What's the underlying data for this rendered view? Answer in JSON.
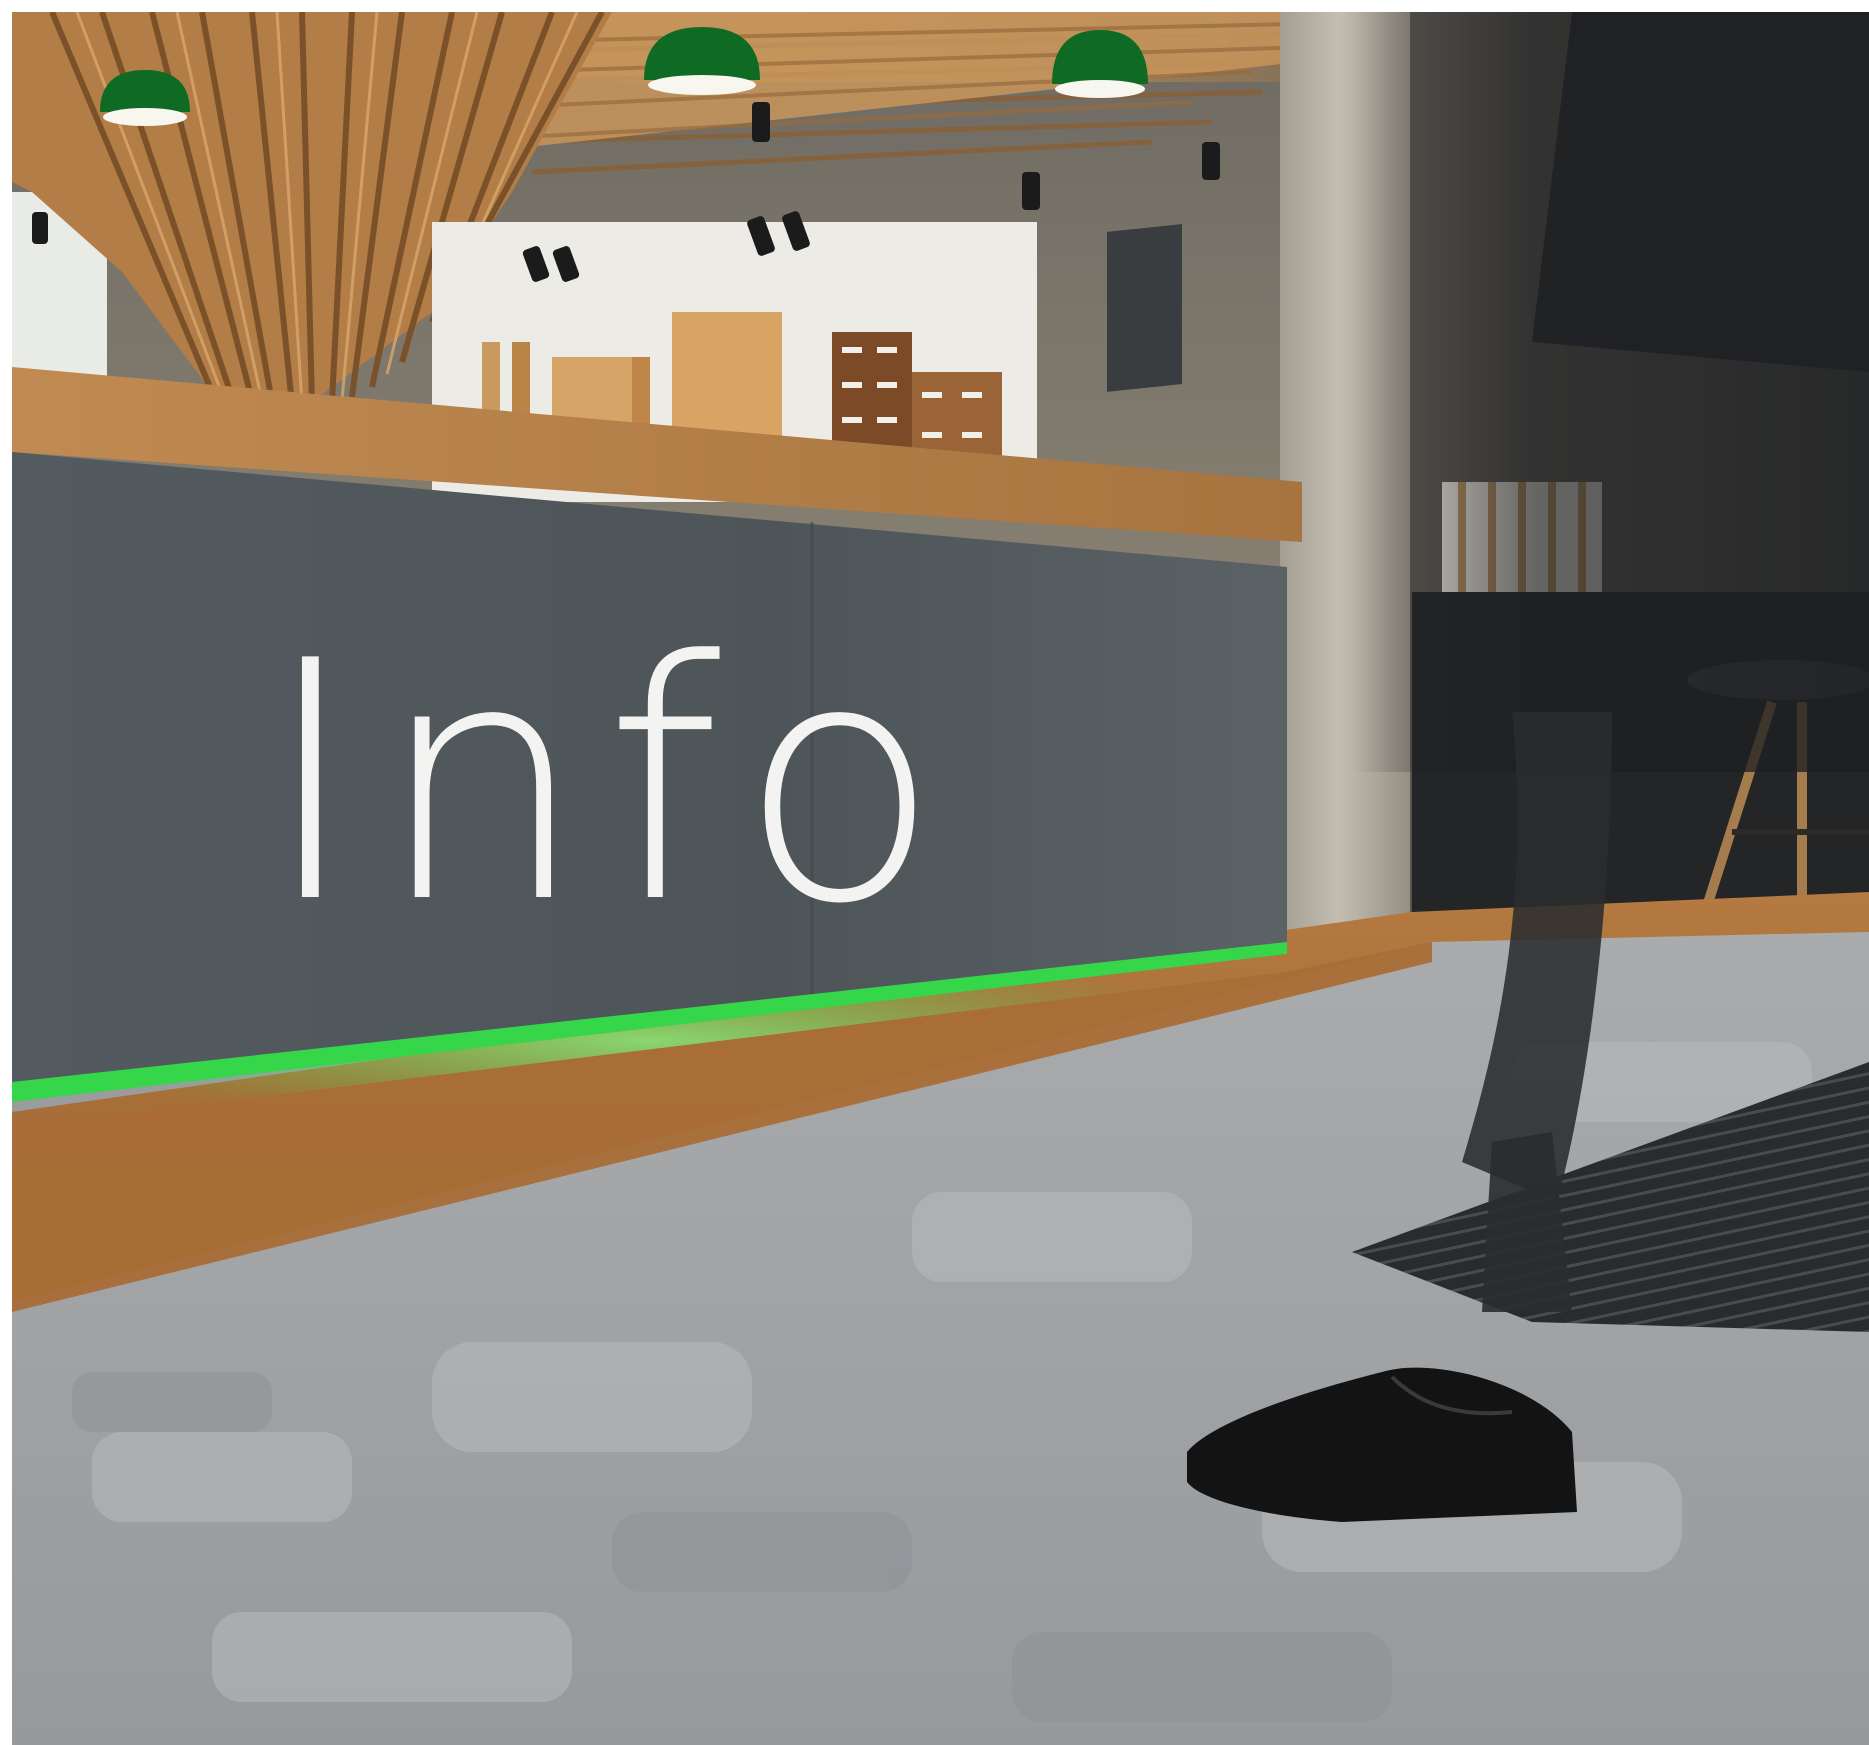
{
  "photo": {
    "sign_text": "Info",
    "colors": {
      "desk_front": "#4d5559",
      "desk_top_wood": "#b7824b",
      "baseboard_wood": "#a86c36",
      "led_strip": "#36d64a",
      "carpet": "#a2a5a8",
      "concrete_wall": "#857e70",
      "ceiling_wood": "#b98a56",
      "pendant_lamp": "#0f6b24",
      "column": "#b8b2a6",
      "shoe": "#131313",
      "trousers": "#2a2c2f",
      "entrance_mat": "#2a2b2d"
    }
  }
}
